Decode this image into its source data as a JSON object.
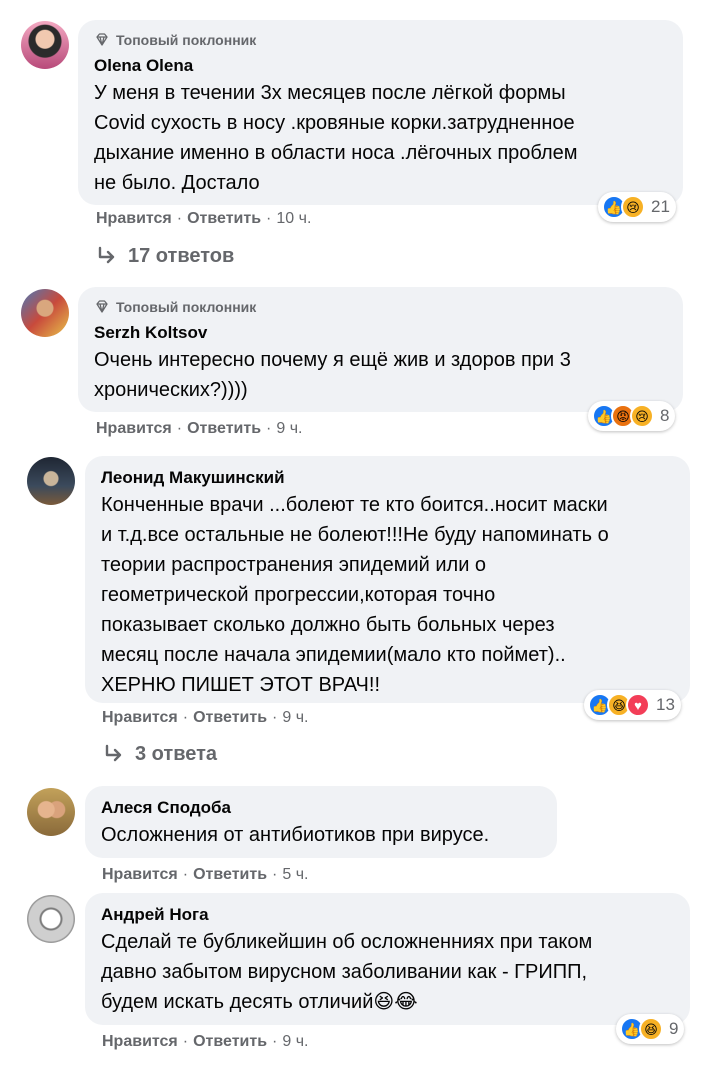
{
  "comments": [
    {
      "badge": "Топовый поклонник",
      "author": "Olena Olena",
      "text": "У меня в течении 3х месяцев после лёгкой формы\nCovid сухость в носу .кровяные корки.затрудненное\nдыхание именно в области носа .лёгочных проблем\nне было. Достало",
      "like": "Нравится",
      "reply": "Ответить",
      "time": "10 ч.",
      "reaction_count": "21",
      "reactions": [
        "like-icon",
        "sad-icon"
      ],
      "replies_label": "17 ответов"
    },
    {
      "badge": "Топовый поклонник",
      "author": "Serzh Koltsov",
      "text": "Очень интересно почему я ещё жив и здоров при 3\nхронических?))))",
      "like": "Нравится",
      "reply": "Ответить",
      "time": "9 ч.",
      "reaction_count": "8",
      "reactions": [
        "like-icon",
        "angry-icon",
        "sad-icon"
      ]
    },
    {
      "author": "Леонид Макушинский",
      "text": "Конченные врачи ...болеют те кто боится..носит маски\nи т.д.все остальные не болеют!!!Не буду напоминать о\nтеории распространения эпидемий или о\nгеометрической прогрессии,которая точно\nпоказывает сколько должно быть больных через\nмесяц после начала эпидемии(мало кто поймет)..\nХЕРНЮ ПИШЕТ ЭТОТ ВРАЧ!!",
      "like": "Нравится",
      "reply": "Ответить",
      "time": "9 ч.",
      "reaction_count": "13",
      "reactions": [
        "like-icon",
        "haha-icon",
        "love-icon"
      ],
      "replies_label": "3 ответа"
    },
    {
      "author": "Алеся Сподоба",
      "text": "Осложнения от антибиотиков при вирусе.",
      "like": "Нравится",
      "reply": "Ответить",
      "time": "5 ч."
    },
    {
      "author": "Андрей Нога",
      "text": "Сделай те бубликейшин об осложненниях при таком\nдавно забытом вирусном заболивании как - ГРИПП,\nбудем искать десять отличий😆😂",
      "like": "Нравится",
      "reply": "Ответить",
      "time": "9 ч.",
      "reaction_count": "9",
      "reactions": [
        "like-icon",
        "haha-icon"
      ]
    }
  ],
  "dot": "·",
  "colors": {
    "bubble": "#f0f2f5",
    "secondary_text": "#65676b",
    "like_blue": "#1877f2",
    "sad_yellow": "#f7b125",
    "angry_orange": "#e9710f",
    "love_red": "#f33e58"
  }
}
